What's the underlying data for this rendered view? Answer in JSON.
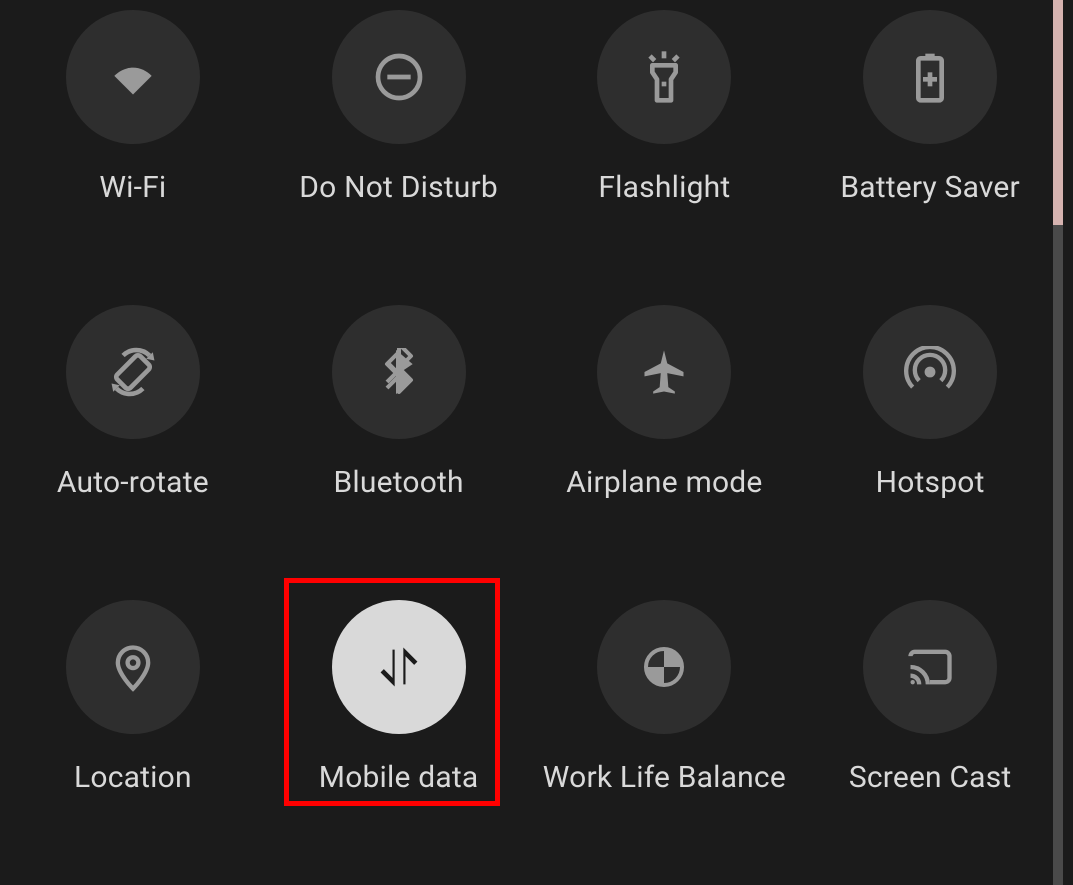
{
  "tiles": [
    {
      "id": "wifi",
      "label": "Wi-Fi",
      "icon": "wifi-icon",
      "active": false,
      "highlighted": false
    },
    {
      "id": "do-not-disturb",
      "label": "Do Not Disturb",
      "icon": "dnd-icon",
      "active": false,
      "highlighted": false
    },
    {
      "id": "flashlight",
      "label": "Flashlight",
      "icon": "flashlight-icon",
      "active": false,
      "highlighted": false
    },
    {
      "id": "battery-saver",
      "label": "Battery Saver",
      "icon": "battery-saver-icon",
      "active": false,
      "highlighted": false
    },
    {
      "id": "auto-rotate",
      "label": "Auto-rotate",
      "icon": "auto-rotate-icon",
      "active": false,
      "highlighted": false
    },
    {
      "id": "bluetooth",
      "label": "Bluetooth",
      "icon": "bluetooth-icon",
      "active": false,
      "highlighted": false
    },
    {
      "id": "airplane-mode",
      "label": "Airplane mode",
      "icon": "airplane-icon",
      "active": false,
      "highlighted": false
    },
    {
      "id": "hotspot",
      "label": "Hotspot",
      "icon": "hotspot-icon",
      "active": false,
      "highlighted": false
    },
    {
      "id": "location",
      "label": "Location",
      "icon": "location-icon",
      "active": false,
      "highlighted": false
    },
    {
      "id": "mobile-data",
      "label": "Mobile data",
      "icon": "mobile-data-icon",
      "active": true,
      "highlighted": true
    },
    {
      "id": "work-life-balance",
      "label": "Work Life Balance",
      "icon": "work-life-icon",
      "active": false,
      "highlighted": false
    },
    {
      "id": "screen-cast",
      "label": "Screen Cast",
      "icon": "screen-cast-icon",
      "active": false,
      "highlighted": false
    }
  ],
  "colors": {
    "background": "#1b1b1b",
    "tile_off": "#2e2e2e",
    "tile_on": "#d9d9d9",
    "icon_off": "#9a9a9a",
    "icon_on": "#1b1b1b",
    "label": "#d9d9d9",
    "highlight": "#ff0000"
  }
}
